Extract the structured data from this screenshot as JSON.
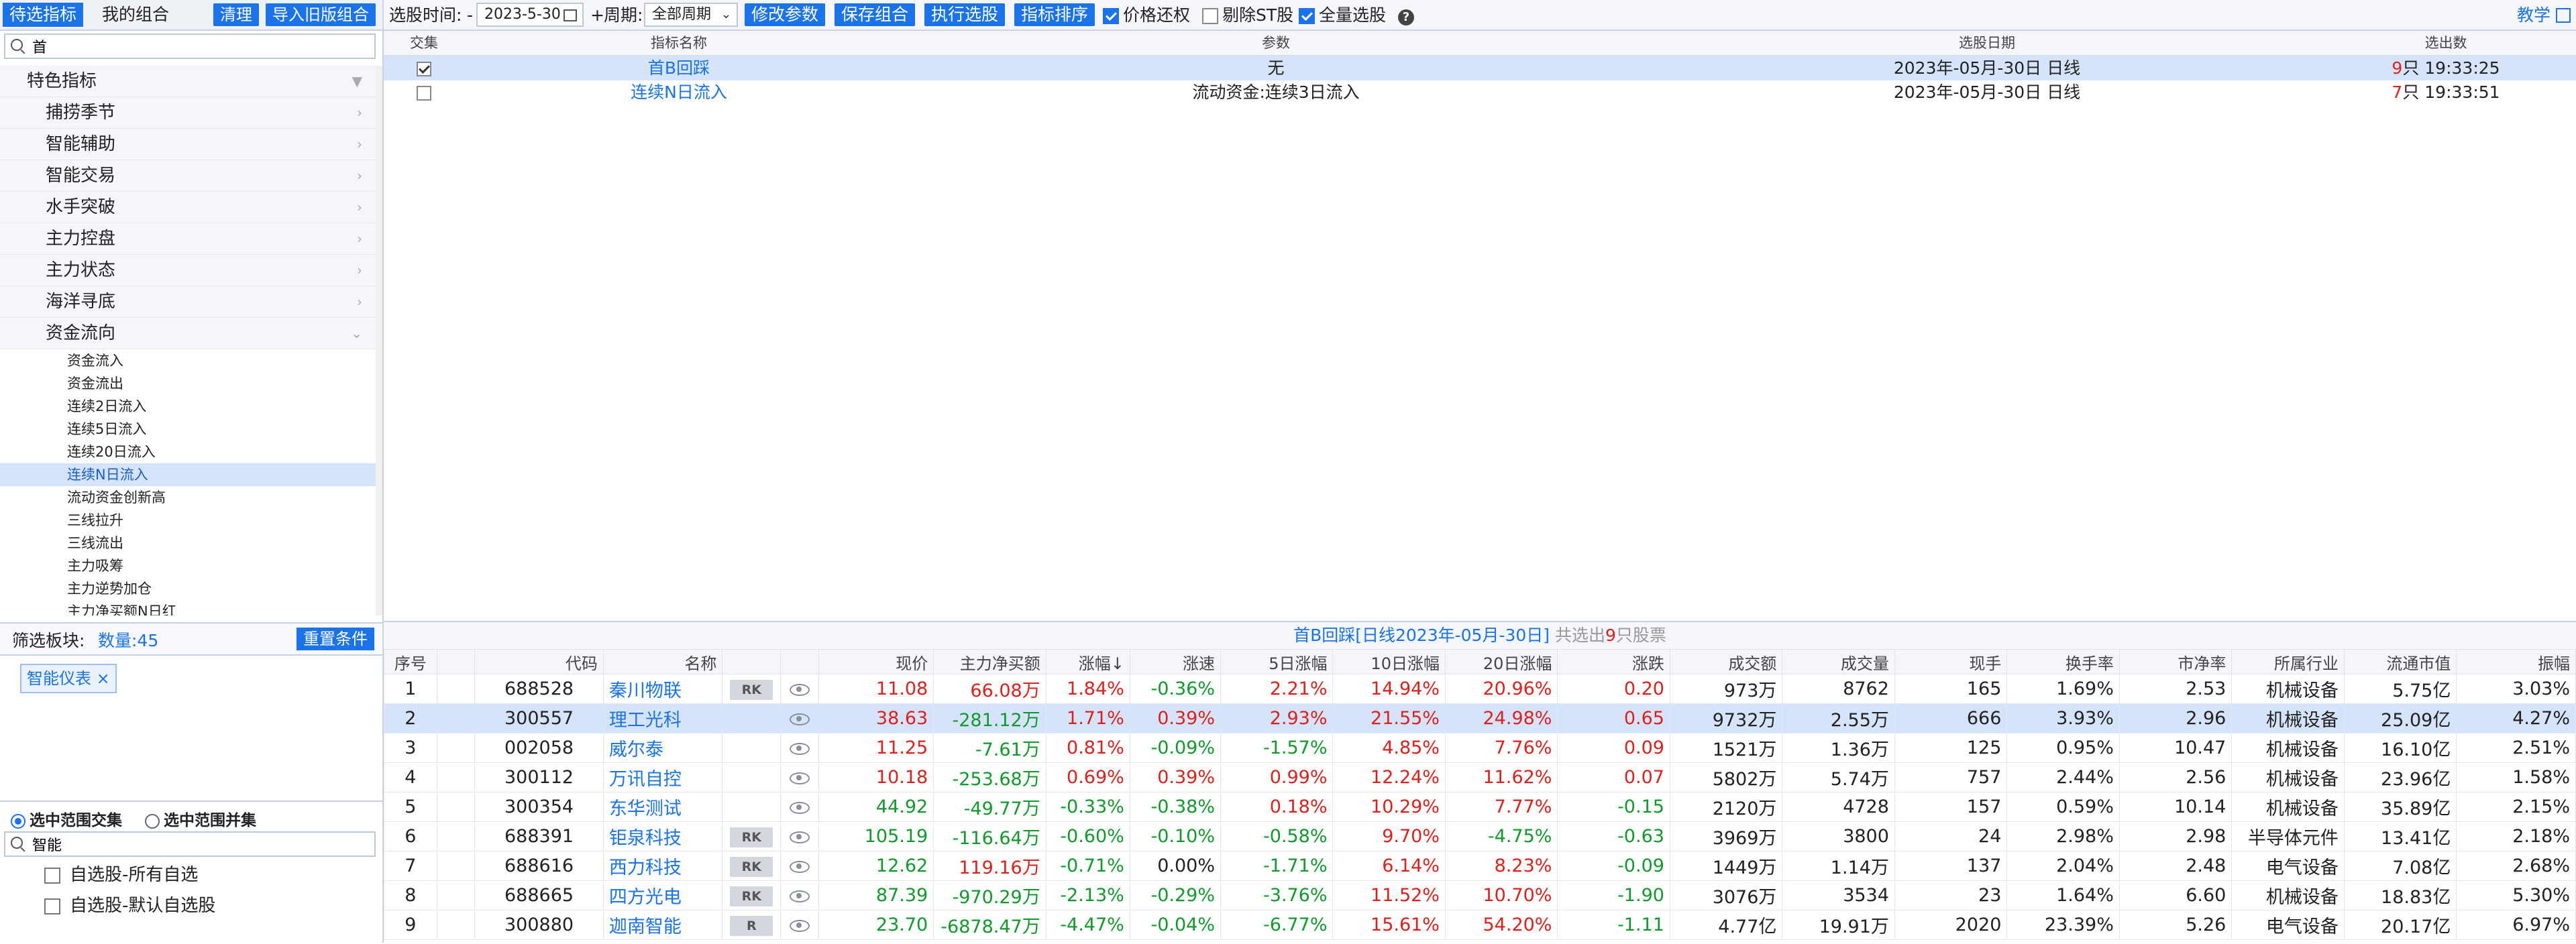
{
  "left": {
    "tabs": [
      "待选指标",
      "我的组合"
    ],
    "buttons": {
      "clear": "清理",
      "import": "导入旧版组合"
    },
    "search_value": "首",
    "tree": {
      "root": "特色指标",
      "groups": [
        "捕捞季节",
        "智能辅助",
        "智能交易",
        "水手突破",
        "主力控盘",
        "主力状态",
        "海洋寻底"
      ],
      "open_group": "资金流向",
      "leaves": [
        "资金流入",
        "资金流出",
        "连续2日流入",
        "连续5日流入",
        "连续20日流入",
        "连续N日流入",
        "流动资金创新高",
        "三线拉升",
        "三线流出",
        "主力吸筹",
        "主力逆势加仓",
        "主力净买额N日红"
      ]
    },
    "filter": {
      "label": "筛选板块:",
      "count": "数量:45",
      "reset": "重置条件",
      "tag": "智能仪表",
      "tag_close": "×"
    },
    "radios": {
      "intersect": "选中范围交集",
      "union": "选中范围并集"
    },
    "search2_value": "智能",
    "bottom_items": [
      "自选股-所有自选",
      "自选股-默认自选股"
    ]
  },
  "toolbar": {
    "time_label": "选股时间:",
    "dash": "-",
    "date": "2023-5-30",
    "plus": "+",
    "period_label": "周期:",
    "period_value": "全部周期",
    "buttons": [
      "修改参数",
      "保存组合",
      "执行选股",
      "指标排序"
    ],
    "checks": {
      "price": "价格还权",
      "st": "剔除ST股",
      "all": "全量选股"
    },
    "help": "?",
    "teach": "教学"
  },
  "indicator_table": {
    "headers": [
      "交集",
      "指标名称",
      "参数",
      "选股日期",
      "选出数"
    ],
    "rows": [
      {
        "name": "首B回踩",
        "param": "无",
        "date": "2023年-05月-30日 日线",
        "count": "9",
        "unit": "只 19:33:25",
        "checked": true
      },
      {
        "name": "连续N日流入",
        "param": "流动资金:连续3日流入",
        "date": "2023年-05月-30日 日线",
        "count": "7",
        "unit": "只 19:33:51",
        "checked": false
      }
    ]
  },
  "result": {
    "title_main": "首B回踩[日线2023年-05月-30日]",
    "title_pre": "共选出",
    "title_count": "9",
    "title_post": "只股票",
    "headers": [
      "序号",
      "",
      "代码",
      "名称",
      "",
      "",
      "现价",
      "主力净买额",
      "涨幅↓",
      "涨速",
      "5日涨幅",
      "10日涨幅",
      "20日涨幅",
      "涨跌",
      "成交额",
      "成交量",
      "现手",
      "换手率",
      "市净率",
      "所属行业",
      "流通市值",
      "振幅"
    ],
    "rows": [
      {
        "idx": "1",
        "code": "688528",
        "name": "秦川物联",
        "badge": "RK",
        "price": "11.08",
        "net": "66.08万",
        "chg": "1.84%",
        "spd": "-0.36%",
        "d5": "2.21%",
        "d10": "14.94%",
        "d20": "20.96%",
        "diff": "0.20",
        "amt": "973万",
        "vol": "8762",
        "hand": "165",
        "turn": "1.69%",
        "pb": "2.53",
        "ind": "机械设备",
        "cap": "5.75亿",
        "amp": "3.03%"
      },
      {
        "idx": "2",
        "code": "300557",
        "name": "理工光科",
        "badge": "",
        "price": "38.63",
        "net": "-281.12万",
        "chg": "1.71%",
        "spd": "0.39%",
        "d5": "2.93%",
        "d10": "21.55%",
        "d20": "24.98%",
        "diff": "0.65",
        "amt": "9732万",
        "vol": "2.55万",
        "hand": "666",
        "turn": "3.93%",
        "pb": "2.96",
        "ind": "机械设备",
        "cap": "25.09亿",
        "amp": "4.27%"
      },
      {
        "idx": "3",
        "code": "002058",
        "name": "威尔泰",
        "badge": "",
        "price": "11.25",
        "net": "-7.61万",
        "chg": "0.81%",
        "spd": "-0.09%",
        "d5": "-1.57%",
        "d10": "4.85%",
        "d20": "7.76%",
        "diff": "0.09",
        "amt": "1521万",
        "vol": "1.36万",
        "hand": "125",
        "turn": "0.95%",
        "pb": "10.47",
        "ind": "机械设备",
        "cap": "16.10亿",
        "amp": "2.51%"
      },
      {
        "idx": "4",
        "code": "300112",
        "name": "万讯自控",
        "badge": "",
        "price": "10.18",
        "net": "-253.68万",
        "chg": "0.69%",
        "spd": "0.39%",
        "d5": "0.99%",
        "d10": "12.24%",
        "d20": "11.62%",
        "diff": "0.07",
        "amt": "5802万",
        "vol": "5.74万",
        "hand": "757",
        "turn": "2.44%",
        "pb": "2.56",
        "ind": "机械设备",
        "cap": "23.96亿",
        "amp": "1.58%"
      },
      {
        "idx": "5",
        "code": "300354",
        "name": "东华测试",
        "badge": "",
        "price": "44.92",
        "net": "-49.77万",
        "chg": "-0.33%",
        "spd": "-0.38%",
        "d5": "0.18%",
        "d10": "10.29%",
        "d20": "7.77%",
        "diff": "-0.15",
        "amt": "2120万",
        "vol": "4728",
        "hand": "157",
        "turn": "0.59%",
        "pb": "10.14",
        "ind": "机械设备",
        "cap": "35.89亿",
        "amp": "2.15%"
      },
      {
        "idx": "6",
        "code": "688391",
        "name": "钜泉科技",
        "badge": "RK",
        "price": "105.19",
        "net": "-116.64万",
        "chg": "-0.60%",
        "spd": "-0.10%",
        "d5": "-0.58%",
        "d10": "9.70%",
        "d20": "-4.75%",
        "diff": "-0.63",
        "amt": "3969万",
        "vol": "3800",
        "hand": "24",
        "turn": "2.98%",
        "pb": "2.98",
        "ind": "半导体元件",
        "cap": "13.41亿",
        "amp": "2.18%"
      },
      {
        "idx": "7",
        "code": "688616",
        "name": "西力科技",
        "badge": "RK",
        "price": "12.62",
        "net": "119.16万",
        "chg": "-0.71%",
        "spd": "0.00%",
        "d5": "-1.71%",
        "d10": "6.14%",
        "d20": "8.23%",
        "diff": "-0.09",
        "amt": "1449万",
        "vol": "1.14万",
        "hand": "137",
        "turn": "2.04%",
        "pb": "2.48",
        "ind": "电气设备",
        "cap": "7.08亿",
        "amp": "2.68%"
      },
      {
        "idx": "8",
        "code": "688665",
        "name": "四方光电",
        "badge": "RK",
        "price": "87.39",
        "net": "-970.29万",
        "chg": "-2.13%",
        "spd": "-0.29%",
        "d5": "-3.76%",
        "d10": "11.52%",
        "d20": "10.70%",
        "diff": "-1.90",
        "amt": "3076万",
        "vol": "3534",
        "hand": "23",
        "turn": "1.64%",
        "pb": "6.60",
        "ind": "机械设备",
        "cap": "18.83亿",
        "amp": "5.30%"
      },
      {
        "idx": "9",
        "code": "300880",
        "name": "迦南智能",
        "badge": "R",
        "price": "23.70",
        "net": "-6878.47万",
        "chg": "-4.47%",
        "spd": "-0.04%",
        "d5": "-6.77%",
        "d10": "15.61%",
        "d20": "54.20%",
        "diff": "-1.11",
        "amt": "4.77亿",
        "vol": "19.91万",
        "hand": "2020",
        "turn": "23.39%",
        "pb": "5.26",
        "ind": "电气设备",
        "cap": "20.17亿",
        "amp": "6.97%"
      }
    ]
  },
  "colors": {
    "accent": "#1a73e8",
    "up": "#e0201b",
    "down": "#119a2c",
    "selected_row": "#d6e4fb"
  }
}
